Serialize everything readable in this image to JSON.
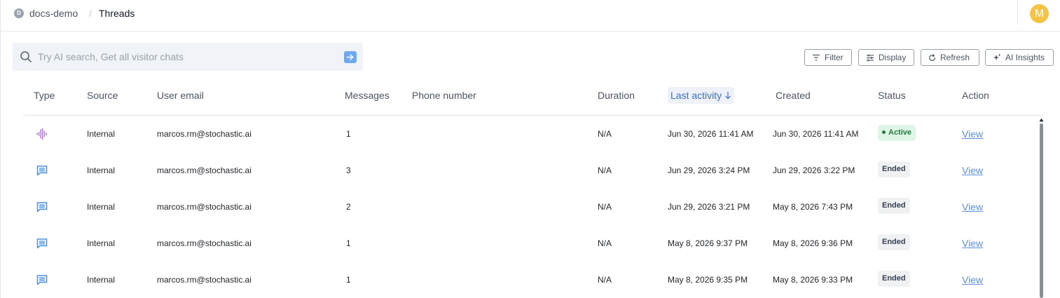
{
  "header": {
    "workspace_initial": "D",
    "workspace": "docs-demo",
    "separator": "/",
    "page_title": "Threads",
    "avatar_initial": "M"
  },
  "search": {
    "placeholder": "Try AI search, Get all visitor chats",
    "value": ""
  },
  "toolbar": {
    "filter": "Filter",
    "display": "Display",
    "refresh": "Refresh",
    "ai_insights": "AI Insights"
  },
  "table": {
    "columns": {
      "type": "Type",
      "source": "Source",
      "user_email": "User email",
      "messages": "Messages",
      "phone": "Phone number",
      "duration": "Duration",
      "last_activity": "Last activity",
      "created": "Created",
      "status": "Status",
      "action": "Action"
    },
    "sort": {
      "column": "last_activity",
      "direction": "descending"
    },
    "rows": [
      {
        "type": "voice",
        "source": "Internal",
        "email": "marcos.rm@stochastic.ai",
        "messages": "1",
        "phone": "",
        "duration": "N/A",
        "last_activity": "Jun 30, 2026 11:41 AM",
        "created": "Jun 30, 2026 11:41 AM",
        "status": "Active",
        "action": "View"
      },
      {
        "type": "chat",
        "source": "Internal",
        "email": "marcos.rm@stochastic.ai",
        "messages": "3",
        "phone": "",
        "duration": "N/A",
        "last_activity": "Jun 29, 2026 3:24 PM",
        "created": "Jun 29, 2026 3:22 PM",
        "status": "Ended",
        "action": "View"
      },
      {
        "type": "chat",
        "source": "Internal",
        "email": "marcos.rm@stochastic.ai",
        "messages": "2",
        "phone": "",
        "duration": "N/A",
        "last_activity": "Jun 29, 2026 3:21 PM",
        "created": "May 8, 2026 7:43 PM",
        "status": "Ended",
        "action": "View"
      },
      {
        "type": "chat",
        "source": "Internal",
        "email": "marcos.rm@stochastic.ai",
        "messages": "1",
        "phone": "",
        "duration": "N/A",
        "last_activity": "May 8, 2026 9:37 PM",
        "created": "May 8, 2026 9:36 PM",
        "status": "Ended",
        "action": "View"
      },
      {
        "type": "chat",
        "source": "Internal",
        "email": "marcos.rm@stochastic.ai",
        "messages": "1",
        "phone": "",
        "duration": "N/A",
        "last_activity": "May 8, 2026 9:35 PM",
        "created": "May 8, 2026 9:33 PM",
        "status": "Ended",
        "action": "View"
      }
    ]
  },
  "colors": {
    "accent": "#5b8fe0",
    "voice_icon": "#b267e6",
    "chat_icon": "#4a90e2",
    "active_bg": "#dff5e5",
    "active_fg": "#1f7a3f",
    "ended_bg": "#eff1f3",
    "avatar": "#f6c445"
  },
  "icons": {
    "voice": "waveform-icon",
    "chat": "chat-bubble-icon",
    "search": "search-icon",
    "submit": "arrow-right-icon",
    "filter": "filter-icon",
    "display": "sliders-icon",
    "refresh": "refresh-icon",
    "ai": "sparkle-icon",
    "sort": "arrow-down-icon"
  }
}
